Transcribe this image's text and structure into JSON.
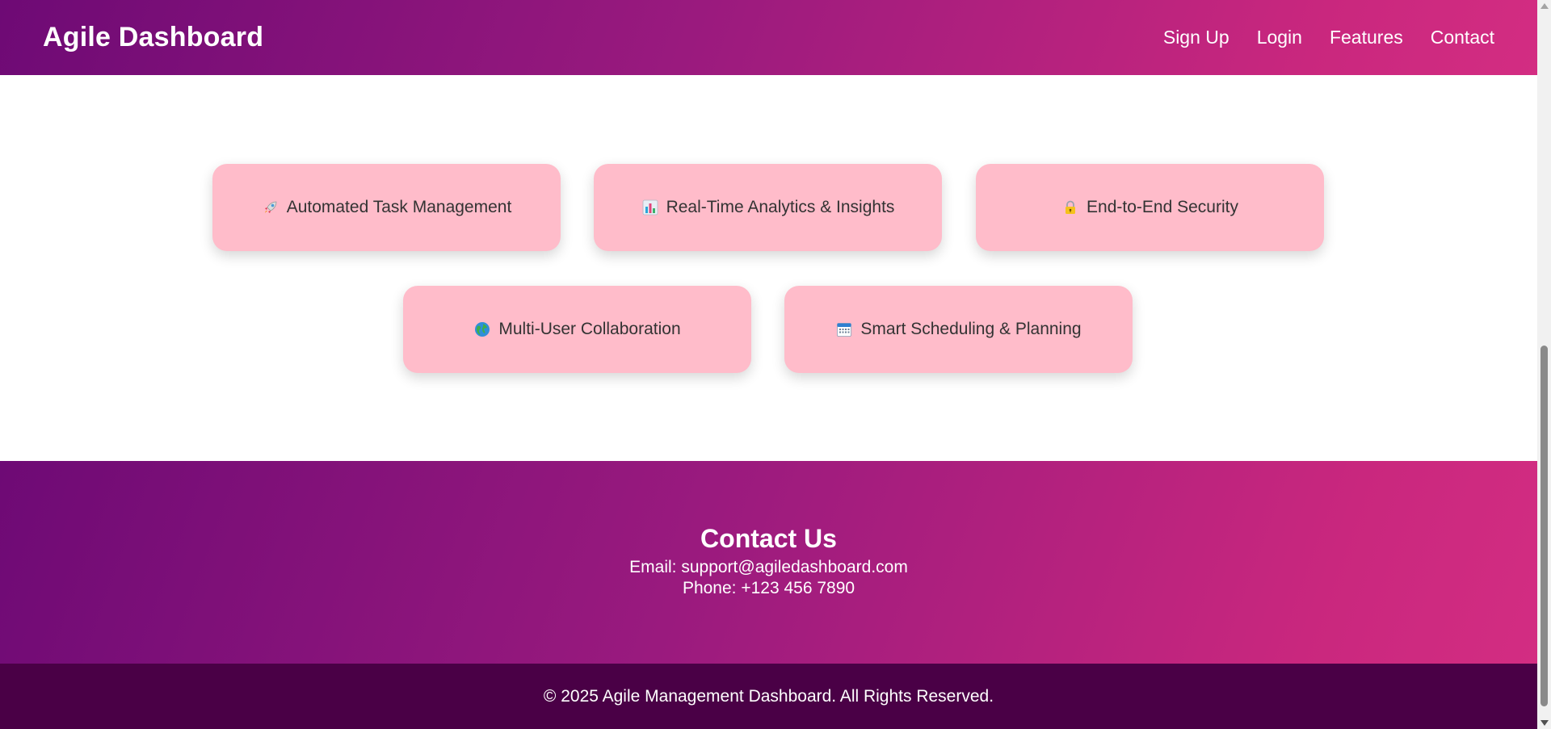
{
  "header": {
    "brand": "Agile Dashboard",
    "nav": [
      "Sign Up",
      "Login",
      "Features",
      "Contact"
    ]
  },
  "features": [
    {
      "icon": "rocket-icon",
      "label": "Automated Task Management"
    },
    {
      "icon": "bar-chart-icon",
      "label": "Real-Time Analytics & Insights"
    },
    {
      "icon": "lock-icon",
      "label": "End-to-End Security"
    },
    {
      "icon": "globe-icon",
      "label": "Multi-User Collaboration"
    },
    {
      "icon": "calendar-icon",
      "label": "Smart Scheduling & Planning"
    }
  ],
  "contact": {
    "title": "Contact Us",
    "email": "Email: support@agiledashboard.com",
    "phone": "Phone: +123 456 7890"
  },
  "footer": {
    "copyright": "© 2025 Agile Management Dashboard. All Rights Reserved."
  },
  "colors": {
    "gradient_start": "#6e0a75",
    "gradient_end": "#d32d82",
    "card_bg": "#ffbcca",
    "footer_bg": "#4a0046"
  }
}
